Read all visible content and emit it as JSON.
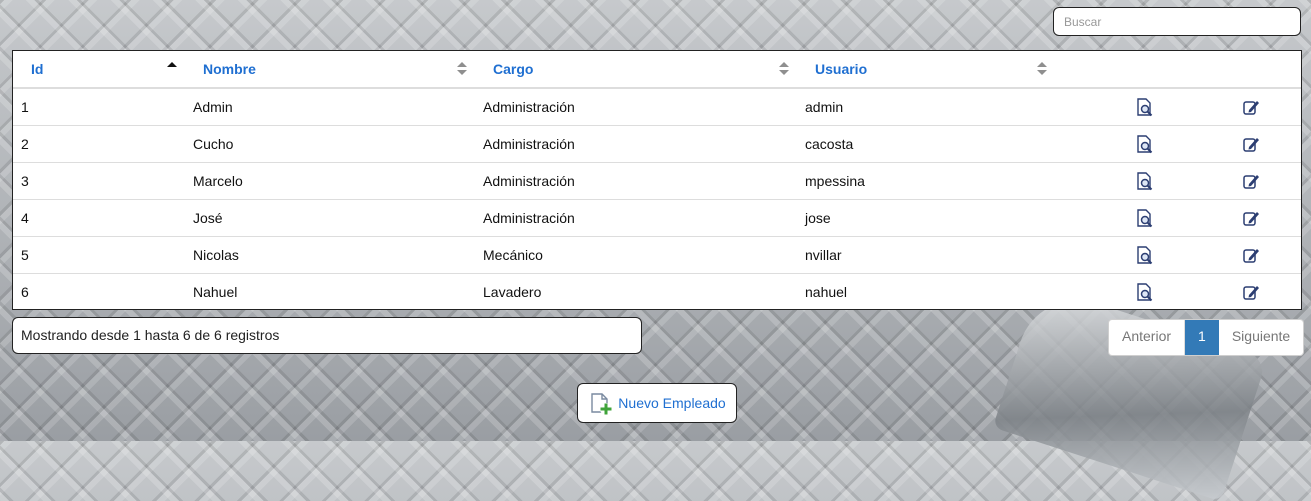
{
  "search": {
    "placeholder": "Buscar"
  },
  "table": {
    "headers": [
      "Id",
      "Nombre",
      "Cargo",
      "Usuario"
    ],
    "rows": [
      {
        "id": "1",
        "nombre": "Admin",
        "cargo": "Administración",
        "usuario": "admin"
      },
      {
        "id": "2",
        "nombre": "Cucho",
        "cargo": "Administración",
        "usuario": "cacosta"
      },
      {
        "id": "3",
        "nombre": "Marcelo",
        "cargo": "Administración",
        "usuario": "mpessina"
      },
      {
        "id": "4",
        "nombre": "José",
        "cargo": "Administración",
        "usuario": "jose"
      },
      {
        "id": "5",
        "nombre": "Nicolas",
        "cargo": "Mecánico",
        "usuario": "nvillar"
      },
      {
        "id": "6",
        "nombre": "Nahuel",
        "cargo": "Lavadero",
        "usuario": "nahuel"
      }
    ],
    "row_icons": [
      "view-details-icon",
      "edit-icon"
    ]
  },
  "footer": {
    "info": "Mostrando desde 1 hasta 6 de 6 registros",
    "pagination": {
      "prev": "Anterior",
      "current": "1",
      "next": "Siguiente"
    }
  },
  "new_button": {
    "label": "Nuevo Empleado",
    "icon": "add-document-icon"
  },
  "colors": {
    "accent": "#1f6fd1",
    "active_page": "#337ab7"
  }
}
